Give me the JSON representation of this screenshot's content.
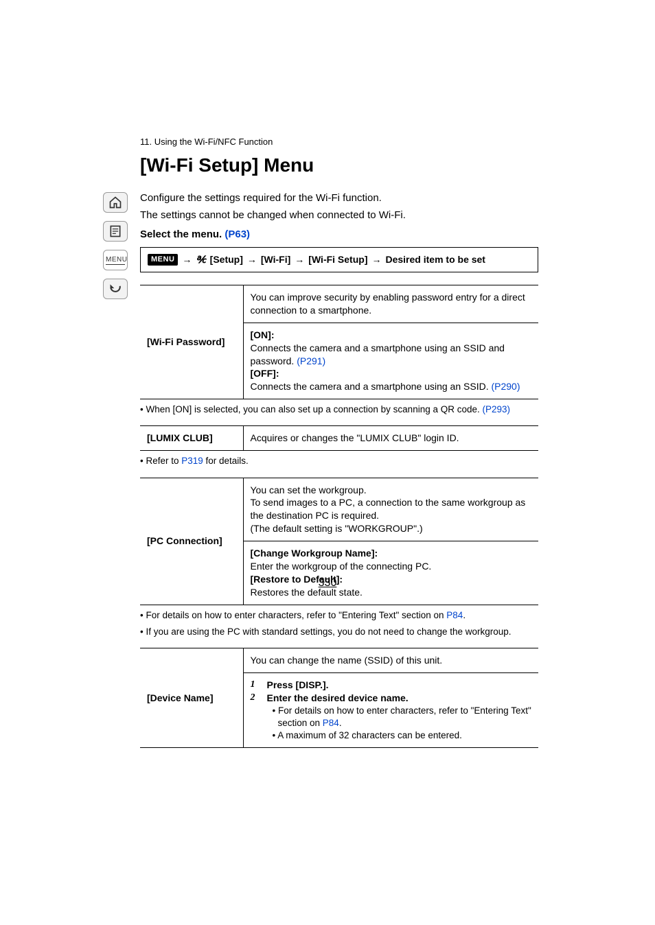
{
  "chapter": "11. Using the Wi-Fi/NFC Function",
  "title": "[Wi-Fi Setup] Menu",
  "intro": [
    "Configure the settings required for the Wi-Fi function.",
    "The settings cannot be changed when connected to Wi-Fi."
  ],
  "select_menu": {
    "text": "Select the menu. ",
    "link": "(P63)"
  },
  "menu_path": {
    "menu_chip": "MENU",
    "segments": [
      "[Setup]",
      "[Wi-Fi]",
      "[Wi-Fi Setup]",
      "Desired item to be set"
    ]
  },
  "sidebar": {
    "home": "home-icon",
    "doc": "document-icon",
    "menu_label": "MENU",
    "back": "back-icon"
  },
  "tables": {
    "wifi_password": {
      "label": "[Wi-Fi Password]",
      "desc_top": "You can improve security by enabling password entry for a direct connection to a smartphone.",
      "on_label": "[ON]:",
      "on_text": "Connects the camera and a smartphone using an SSID and password. ",
      "on_link": "(P291)",
      "off_label": "[OFF]:",
      "off_text": "Connects the camera and a smartphone using an SSID. ",
      "off_link": "(P290)"
    },
    "wifi_password_note": {
      "prefix": "• When [ON] is selected, you can also set up a connection by scanning a QR code. ",
      "link": "(P293)"
    },
    "lumix_club": {
      "label": "[LUMIX CLUB]",
      "desc": "Acquires or changes the \"LUMIX CLUB\" login ID."
    },
    "lumix_club_note": {
      "prefix": "• Refer to ",
      "link": "P319",
      "suffix": " for details."
    },
    "pc_connection": {
      "label": "[PC Connection]",
      "desc_top_lines": [
        "You can set the workgroup.",
        "To send images to a PC, a connection to the same workgroup as the destination PC is required.",
        "(The default setting is \"WORKGROUP\".)"
      ],
      "change_label": "[Change Workgroup Name]:",
      "change_text": "Enter the workgroup of the connecting PC.",
      "restore_label": "[Restore to Default]:",
      "restore_text": "Restores the default state."
    },
    "pc_connection_notes": [
      {
        "prefix": "• For details on how to enter characters, refer to \"Entering Text\" section on ",
        "link": "P84",
        "suffix": "."
      },
      {
        "text": "• If you are using the PC with standard settings, you do not need to change the workgroup."
      }
    ],
    "device_name": {
      "label": "[Device Name]",
      "desc_top": "You can change the name (SSID) of this unit.",
      "steps": [
        {
          "num": "1",
          "bold": "Press [DISP.]."
        },
        {
          "num": "2",
          "bold": "Enter the desired device name.",
          "subs": [
            {
              "prefix": "• For details on how to enter characters, refer to \"Entering Text\" section on ",
              "link": "P84",
              "suffix": "."
            },
            {
              "text": "• A maximum of 32 characters can be entered."
            }
          ]
        }
      ]
    }
  },
  "page_number": "330"
}
